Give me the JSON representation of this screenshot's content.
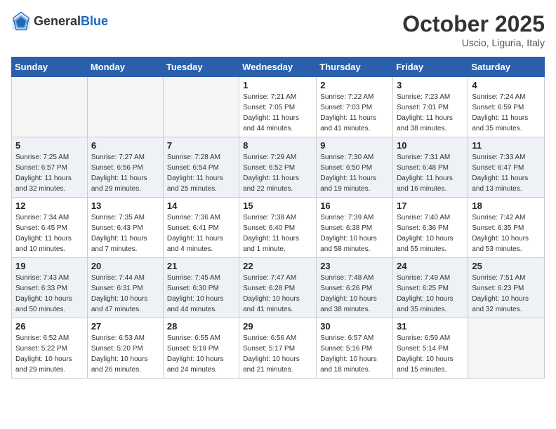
{
  "header": {
    "logo_general": "General",
    "logo_blue": "Blue",
    "month_year": "October 2025",
    "location": "Uscio, Liguria, Italy"
  },
  "days_of_week": [
    "Sunday",
    "Monday",
    "Tuesday",
    "Wednesday",
    "Thursday",
    "Friday",
    "Saturday"
  ],
  "weeks": [
    {
      "days": [
        {
          "num": "",
          "info": ""
        },
        {
          "num": "",
          "info": ""
        },
        {
          "num": "",
          "info": ""
        },
        {
          "num": "1",
          "info": "Sunrise: 7:21 AM\nSunset: 7:05 PM\nDaylight: 11 hours\nand 44 minutes."
        },
        {
          "num": "2",
          "info": "Sunrise: 7:22 AM\nSunset: 7:03 PM\nDaylight: 11 hours\nand 41 minutes."
        },
        {
          "num": "3",
          "info": "Sunrise: 7:23 AM\nSunset: 7:01 PM\nDaylight: 11 hours\nand 38 minutes."
        },
        {
          "num": "4",
          "info": "Sunrise: 7:24 AM\nSunset: 6:59 PM\nDaylight: 11 hours\nand 35 minutes."
        }
      ]
    },
    {
      "days": [
        {
          "num": "5",
          "info": "Sunrise: 7:25 AM\nSunset: 6:57 PM\nDaylight: 11 hours\nand 32 minutes."
        },
        {
          "num": "6",
          "info": "Sunrise: 7:27 AM\nSunset: 6:56 PM\nDaylight: 11 hours\nand 29 minutes."
        },
        {
          "num": "7",
          "info": "Sunrise: 7:28 AM\nSunset: 6:54 PM\nDaylight: 11 hours\nand 25 minutes."
        },
        {
          "num": "8",
          "info": "Sunrise: 7:29 AM\nSunset: 6:52 PM\nDaylight: 11 hours\nand 22 minutes."
        },
        {
          "num": "9",
          "info": "Sunrise: 7:30 AM\nSunset: 6:50 PM\nDaylight: 11 hours\nand 19 minutes."
        },
        {
          "num": "10",
          "info": "Sunrise: 7:31 AM\nSunset: 6:48 PM\nDaylight: 11 hours\nand 16 minutes."
        },
        {
          "num": "11",
          "info": "Sunrise: 7:33 AM\nSunset: 6:47 PM\nDaylight: 11 hours\nand 13 minutes."
        }
      ]
    },
    {
      "days": [
        {
          "num": "12",
          "info": "Sunrise: 7:34 AM\nSunset: 6:45 PM\nDaylight: 11 hours\nand 10 minutes."
        },
        {
          "num": "13",
          "info": "Sunrise: 7:35 AM\nSunset: 6:43 PM\nDaylight: 11 hours\nand 7 minutes."
        },
        {
          "num": "14",
          "info": "Sunrise: 7:36 AM\nSunset: 6:41 PM\nDaylight: 11 hours\nand 4 minutes."
        },
        {
          "num": "15",
          "info": "Sunrise: 7:38 AM\nSunset: 6:40 PM\nDaylight: 11 hours\nand 1 minute."
        },
        {
          "num": "16",
          "info": "Sunrise: 7:39 AM\nSunset: 6:38 PM\nDaylight: 10 hours\nand 58 minutes."
        },
        {
          "num": "17",
          "info": "Sunrise: 7:40 AM\nSunset: 6:36 PM\nDaylight: 10 hours\nand 55 minutes."
        },
        {
          "num": "18",
          "info": "Sunrise: 7:42 AM\nSunset: 6:35 PM\nDaylight: 10 hours\nand 53 minutes."
        }
      ]
    },
    {
      "days": [
        {
          "num": "19",
          "info": "Sunrise: 7:43 AM\nSunset: 6:33 PM\nDaylight: 10 hours\nand 50 minutes."
        },
        {
          "num": "20",
          "info": "Sunrise: 7:44 AM\nSunset: 6:31 PM\nDaylight: 10 hours\nand 47 minutes."
        },
        {
          "num": "21",
          "info": "Sunrise: 7:45 AM\nSunset: 6:30 PM\nDaylight: 10 hours\nand 44 minutes."
        },
        {
          "num": "22",
          "info": "Sunrise: 7:47 AM\nSunset: 6:28 PM\nDaylight: 10 hours\nand 41 minutes."
        },
        {
          "num": "23",
          "info": "Sunrise: 7:48 AM\nSunset: 6:26 PM\nDaylight: 10 hours\nand 38 minutes."
        },
        {
          "num": "24",
          "info": "Sunrise: 7:49 AM\nSunset: 6:25 PM\nDaylight: 10 hours\nand 35 minutes."
        },
        {
          "num": "25",
          "info": "Sunrise: 7:51 AM\nSunset: 6:23 PM\nDaylight: 10 hours\nand 32 minutes."
        }
      ]
    },
    {
      "days": [
        {
          "num": "26",
          "info": "Sunrise: 6:52 AM\nSunset: 5:22 PM\nDaylight: 10 hours\nand 29 minutes."
        },
        {
          "num": "27",
          "info": "Sunrise: 6:53 AM\nSunset: 5:20 PM\nDaylight: 10 hours\nand 26 minutes."
        },
        {
          "num": "28",
          "info": "Sunrise: 6:55 AM\nSunset: 5:19 PM\nDaylight: 10 hours\nand 24 minutes."
        },
        {
          "num": "29",
          "info": "Sunrise: 6:56 AM\nSunset: 5:17 PM\nDaylight: 10 hours\nand 21 minutes."
        },
        {
          "num": "30",
          "info": "Sunrise: 6:57 AM\nSunset: 5:16 PM\nDaylight: 10 hours\nand 18 minutes."
        },
        {
          "num": "31",
          "info": "Sunrise: 6:59 AM\nSunset: 5:14 PM\nDaylight: 10 hours\nand 15 minutes."
        },
        {
          "num": "",
          "info": ""
        }
      ]
    }
  ]
}
